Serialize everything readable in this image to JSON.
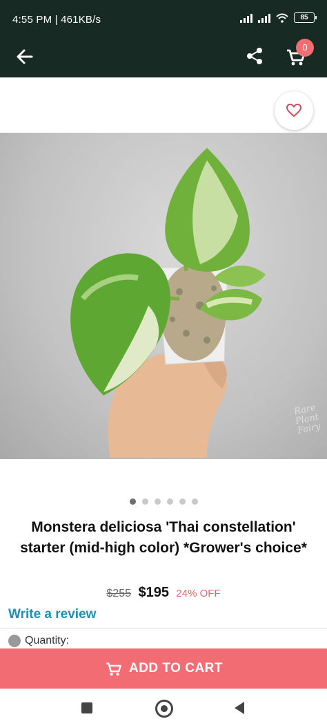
{
  "status": {
    "time_speed": "4:55 PM | 461KB/s",
    "battery": "85"
  },
  "header": {
    "cart_count": "0"
  },
  "product": {
    "title": "Monstera deliciosa 'Thai constellation' starter (mid-high color) *Grower's choice*",
    "old_price": "$255",
    "price": "$195",
    "discount": "24% OFF",
    "image_watermark": "Rare Plant Fairy",
    "carousel": {
      "count": 6,
      "active_index": 0
    }
  },
  "review_link": "Write a review",
  "quantity_label": "Quantity:",
  "add_to_cart": "ADD TO CART",
  "colors": {
    "header_bg": "#182a24",
    "accent": "#f26d73",
    "link": "#1f8fb3"
  },
  "icons": {
    "back": "arrow-left-icon",
    "share": "share-icon",
    "cart": "cart-icon",
    "wishlist": "heart-icon",
    "cta": "cart-icon"
  }
}
